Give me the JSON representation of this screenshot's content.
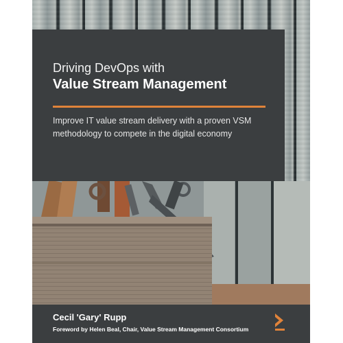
{
  "cover": {
    "title_line1": "Driving DevOps with",
    "title_line2": "Value Stream Management",
    "subtitle": "Improve IT value stream delivery with a proven VSM methodology to compete in the digital economy",
    "author": "Cecil 'Gary' Rupp",
    "foreword": "Foreword by Helen Beal, Chair, Value Stream Management Consortium",
    "accent_color": "#e0833a",
    "panel_color": "#3b3e40",
    "logo_icon": "publisher-chevron-logo",
    "illustration": "wooden-toolbox-with-old-tools"
  }
}
